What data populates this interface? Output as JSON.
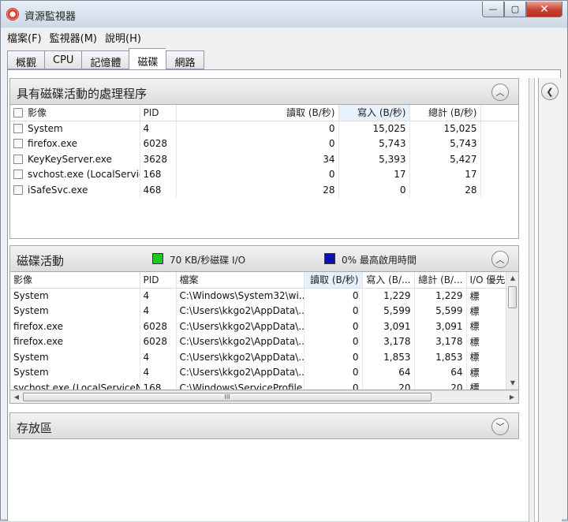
{
  "window": {
    "title": "資源監視器",
    "minimize": "—",
    "maximize": "▢",
    "close": "✕"
  },
  "menu": [
    {
      "label": "檔案(F)"
    },
    {
      "label": "監視器(M)"
    },
    {
      "label": "說明(H)"
    }
  ],
  "tabs": [
    {
      "label": "概觀"
    },
    {
      "label": "CPU"
    },
    {
      "label": "記憶體"
    },
    {
      "label": "磁碟"
    },
    {
      "label": "網路"
    }
  ],
  "active_tab": "磁碟",
  "processes": {
    "title": "具有磁碟活動的處理程序",
    "columns": [
      "影像",
      "PID",
      "讀取 (B/秒)",
      "寫入 (B/秒)",
      "總計 (B/秒)"
    ],
    "rows": [
      [
        "System",
        "4",
        "0",
        "15,025",
        "15,025"
      ],
      [
        "firefox.exe",
        "6028",
        "0",
        "5,743",
        "5,743"
      ],
      [
        "KeyKeyServer.exe",
        "3628",
        "34",
        "5,393",
        "5,427"
      ],
      [
        "svchost.exe (LocalServic...",
        "168",
        "0",
        "17",
        "17"
      ],
      [
        "iSafeSvc.exe",
        "468",
        "28",
        "0",
        "28"
      ]
    ]
  },
  "disk_activity": {
    "title": "磁碟活動",
    "legend_io": "70 KB/秒磁碟 I/O",
    "legend_active": "0% 最高啟用時間",
    "color_io": "#22c622",
    "color_active": "#1010b0",
    "columns": [
      "影像",
      "PID",
      "檔案",
      "讀取 (B/秒)",
      "寫入 (B/...",
      "總計 (B/...",
      "I/O 優先"
    ],
    "rows": [
      [
        "System",
        "4",
        "C:\\Windows\\System32\\wi...",
        "0",
        "1,229",
        "1,229",
        "標"
      ],
      [
        "System",
        "4",
        "C:\\Users\\kkgo2\\AppData\\...",
        "0",
        "5,599",
        "5,599",
        "標"
      ],
      [
        "firefox.exe",
        "6028",
        "C:\\Users\\kkgo2\\AppData\\...",
        "0",
        "3,091",
        "3,091",
        "標"
      ],
      [
        "firefox.exe",
        "6028",
        "C:\\Users\\kkgo2\\AppData\\...",
        "0",
        "3,178",
        "3,178",
        "標"
      ],
      [
        "System",
        "4",
        "C:\\Users\\kkgo2\\AppData\\...",
        "0",
        "1,853",
        "1,853",
        "標"
      ],
      [
        "System",
        "4",
        "C:\\Users\\kkgo2\\AppData\\...",
        "0",
        "64",
        "64",
        "標"
      ],
      [
        "svchost.exe (LocalServiceN...",
        "168",
        "C:\\Windows\\ServiceProfile...",
        "0",
        "20",
        "20",
        "標"
      ]
    ],
    "hscroll_grip": "III"
  },
  "storage": {
    "title": "存放區"
  }
}
